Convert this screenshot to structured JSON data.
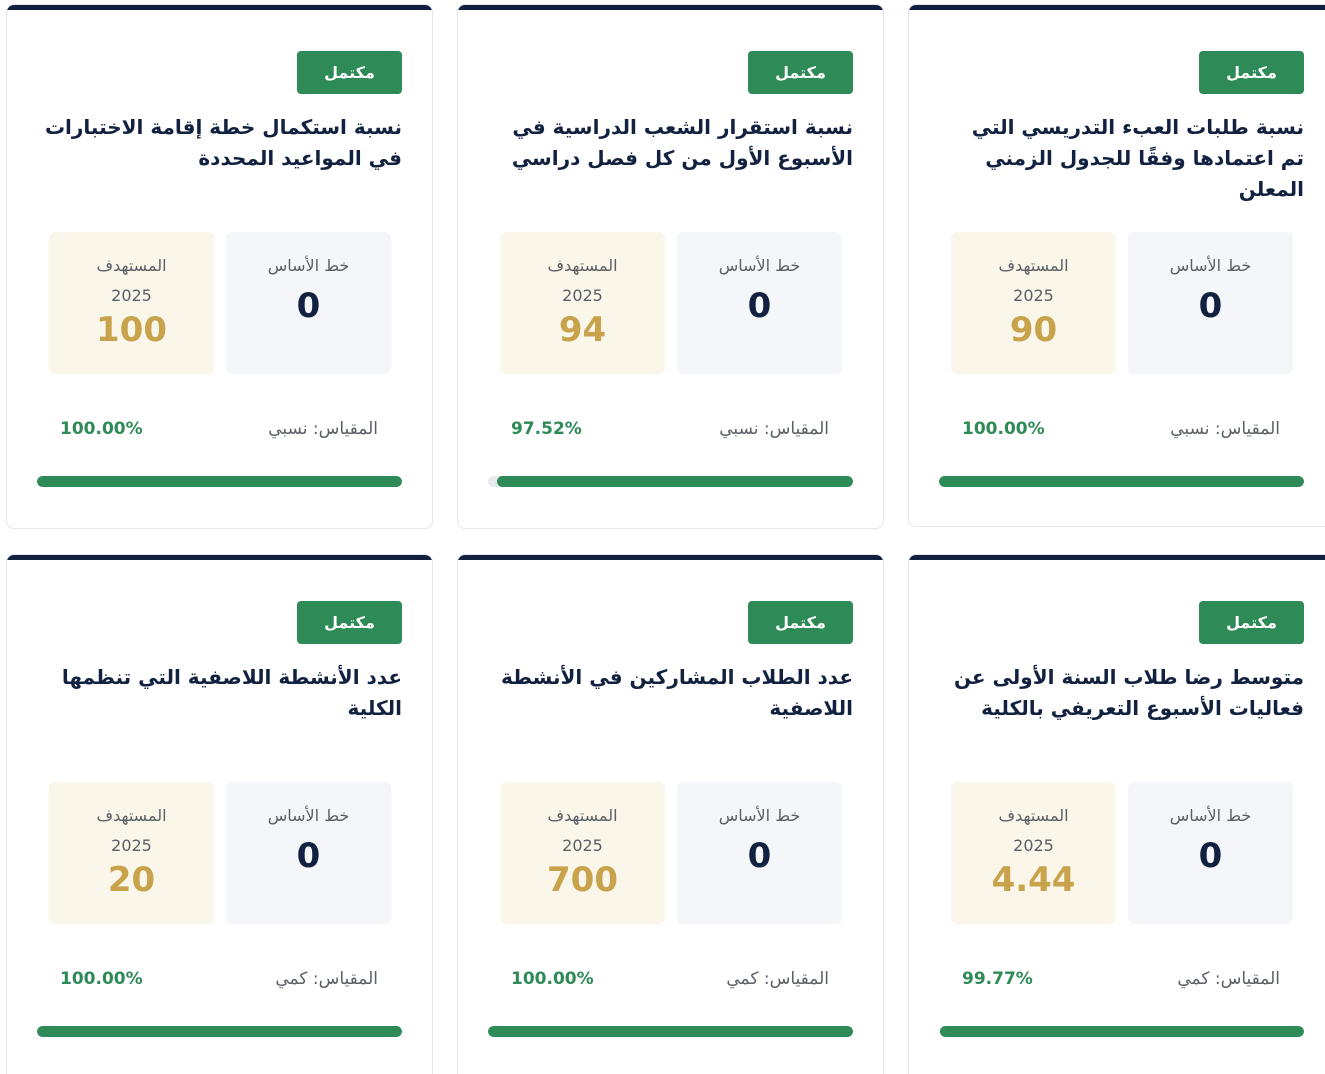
{
  "labels": {
    "baseline": "خط الأساس",
    "target": "المستهدف",
    "year": "2025"
  },
  "colors": {
    "header_bar": "#12213f",
    "badge": "#2e8a57",
    "progress": "#2e8a57",
    "target_value": "#c9a24c"
  },
  "cards": [
    {
      "status": "مكتمل",
      "title": "نسبة طلبات العبء التدريسي التي تم اعتمادها وفقًا للجدول الزمني المعلن",
      "baseline": "0",
      "target": "90",
      "measure": "المقياس: نسبي",
      "percent": "100.00%",
      "progress": 100
    },
    {
      "status": "مكتمل",
      "title": "نسبة استقرار الشعب الدراسية في الأسبوع الأول من كل فصل دراسي",
      "baseline": "0",
      "target": "94",
      "measure": "المقياس: نسبي",
      "percent": "97.52%",
      "progress": 97.52
    },
    {
      "status": "مكتمل",
      "title": "نسبة استكمال خطة إقامة الاختبارات في المواعيد المحددة",
      "baseline": "0",
      "target": "100",
      "measure": "المقياس: نسبي",
      "percent": "100.00%",
      "progress": 100
    },
    {
      "status": "مكتمل",
      "title": "متوسط رضا طلاب السنة الأولى عن فعاليات الأسبوع التعريفي بالكلية",
      "baseline": "0",
      "target": "4.44",
      "measure": "المقياس: كمي",
      "percent": "99.77%",
      "progress": 99.77
    },
    {
      "status": "مكتمل",
      "title": "عدد الطلاب المشاركين في الأنشطة اللاصفية",
      "baseline": "0",
      "target": "700",
      "measure": "المقياس: كمي",
      "percent": "100.00%",
      "progress": 100
    },
    {
      "status": "مكتمل",
      "title": "عدد الأنشطة اللاصفية التي تنظمها الكلية",
      "baseline": "0",
      "target": "20",
      "measure": "المقياس: كمي",
      "percent": "100.00%",
      "progress": 100
    }
  ]
}
